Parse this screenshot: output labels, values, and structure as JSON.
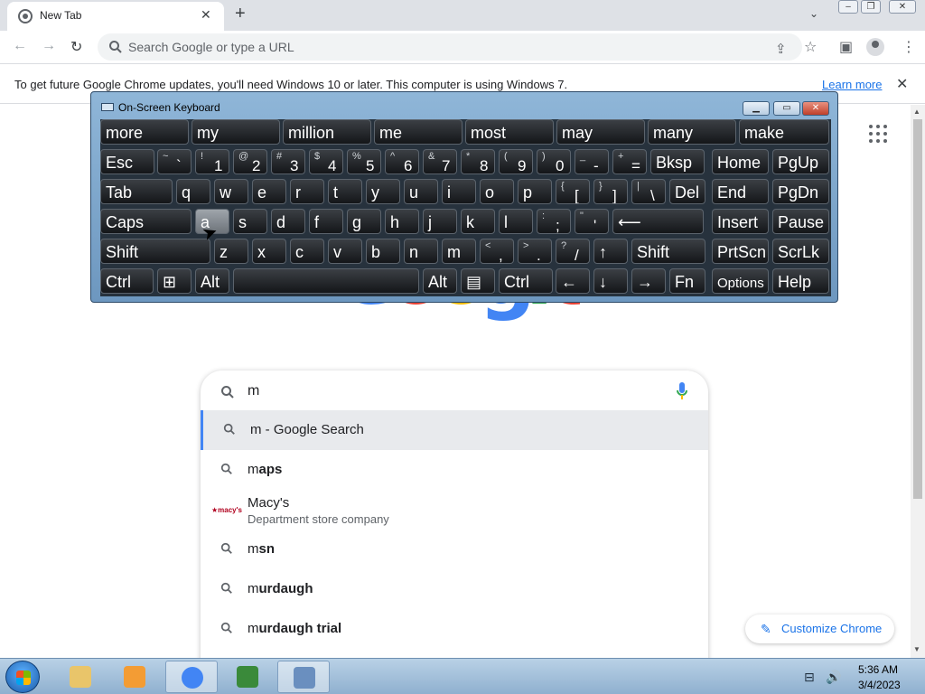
{
  "tab": {
    "title": "New Tab",
    "close": "✕",
    "new_tab": "+"
  },
  "window_controls": {
    "minimize": "▭",
    "restore": "❐",
    "close": "✕"
  },
  "toolbar": {
    "back": "←",
    "forward": "→",
    "reload": "↻",
    "share": "⇪",
    "bookmark": "☆",
    "sidepanel": "▣",
    "menu": "⋮"
  },
  "omnibox": {
    "placeholder": "Search Google or type a URL"
  },
  "infobar": {
    "message": "To get future Google Chrome updates, you'll need Windows 10 or later. This computer is using Windows 7.",
    "link": "Learn more",
    "close": "✕"
  },
  "google_logo": {
    "letters": [
      "G",
      "o",
      "o",
      "g",
      "l",
      "e"
    ],
    "colors": [
      "#4285f4",
      "#ea4335",
      "#fbbc05",
      "#4285f4",
      "#34a853",
      "#ea4335"
    ]
  },
  "search": {
    "query": "m",
    "suggestions": [
      {
        "typed": "m",
        "rest": " - Google Search",
        "active": true
      },
      {
        "typed": "m",
        "rest": "aps"
      },
      {
        "title": "Macy's",
        "subtitle": "Department store company",
        "logo": "★macy's"
      },
      {
        "typed": "m",
        "rest": "sn"
      },
      {
        "typed": "m",
        "rest": "urdaugh"
      },
      {
        "typed": "m",
        "rest": "urdaugh trial"
      }
    ]
  },
  "customize": {
    "label": "Customize Chrome",
    "icon": "✎"
  },
  "osk": {
    "title": "On-Screen Keyboard",
    "controls": {
      "minimize": "▁",
      "restore": "▭",
      "close": "✕"
    },
    "predictions": [
      "more",
      "my",
      "million",
      "me",
      "most",
      "may",
      "many",
      "make"
    ],
    "row1": [
      {
        "l": "Esc"
      },
      {
        "s": "~",
        "b": "`"
      },
      {
        "s": "!",
        "b": "1"
      },
      {
        "s": "@",
        "b": "2"
      },
      {
        "s": "#",
        "b": "3"
      },
      {
        "s": "$",
        "b": "4"
      },
      {
        "s": "%",
        "b": "5"
      },
      {
        "s": "^",
        "b": "6"
      },
      {
        "s": "&",
        "b": "7"
      },
      {
        "s": "*",
        "b": "8"
      },
      {
        "s": "(",
        "b": "9"
      },
      {
        "s": ")",
        "b": "0"
      },
      {
        "s": "_",
        "b": "-"
      },
      {
        "s": "+",
        "b": "="
      },
      {
        "l": "Bksp"
      },
      {
        "l": "Home"
      },
      {
        "l": "PgUp"
      }
    ],
    "row2": [
      {
        "l": "Tab"
      },
      {
        "l": "q"
      },
      {
        "l": "w"
      },
      {
        "l": "e"
      },
      {
        "l": "r"
      },
      {
        "l": "t"
      },
      {
        "l": "y"
      },
      {
        "l": "u"
      },
      {
        "l": "i"
      },
      {
        "l": "o"
      },
      {
        "l": "p"
      },
      {
        "s": "{",
        "b": "["
      },
      {
        "s": "}",
        "b": "]"
      },
      {
        "s": "|",
        "b": "\\"
      },
      {
        "l": "Del"
      },
      {
        "l": "End"
      },
      {
        "l": "PgDn"
      }
    ],
    "row3": [
      {
        "l": "Caps"
      },
      {
        "l": "a"
      },
      {
        "l": "s"
      },
      {
        "l": "d"
      },
      {
        "l": "f"
      },
      {
        "l": "g"
      },
      {
        "l": "h"
      },
      {
        "l": "j"
      },
      {
        "l": "k"
      },
      {
        "l": "l"
      },
      {
        "s": ":",
        "b": ";"
      },
      {
        "s": "\"",
        "b": "'"
      },
      {
        "l": "⟵"
      },
      {
        "l": "Insert"
      },
      {
        "l": "Pause"
      }
    ],
    "row4": [
      {
        "l": "Shift"
      },
      {
        "l": "z"
      },
      {
        "l": "x"
      },
      {
        "l": "c"
      },
      {
        "l": "v"
      },
      {
        "l": "b"
      },
      {
        "l": "n"
      },
      {
        "l": "m"
      },
      {
        "s": "<",
        "b": ","
      },
      {
        "s": ">",
        "b": "."
      },
      {
        "s": "?",
        "b": "/"
      },
      {
        "l": "↑"
      },
      {
        "l": "Shift"
      },
      {
        "l": "PrtScn"
      },
      {
        "l": "ScrLk"
      }
    ],
    "row5": [
      {
        "l": "Ctrl"
      },
      {
        "l": "⊞"
      },
      {
        "l": "Alt"
      },
      {
        "l": ""
      },
      {
        "l": "Alt"
      },
      {
        "l": "▤"
      },
      {
        "l": "Ctrl"
      },
      {
        "l": "←"
      },
      {
        "l": "↓"
      },
      {
        "l": "→"
      },
      {
        "l": "Fn"
      },
      {
        "l": "Options"
      },
      {
        "l": "Help"
      }
    ]
  },
  "taskbar": {
    "apps": [
      {
        "name": "explorer",
        "color": "#e9c56a"
      },
      {
        "name": "media-player",
        "color": "#f39c34"
      },
      {
        "name": "chrome",
        "color": "#4285f4"
      },
      {
        "name": "csharp",
        "color": "#3a8a3a"
      },
      {
        "name": "on-screen-keyboard",
        "color": "#6a8fbf"
      }
    ],
    "time": "5:36 AM",
    "date": "3/4/2023",
    "tray": {
      "network": "⊟",
      "volume": "🔊"
    }
  }
}
